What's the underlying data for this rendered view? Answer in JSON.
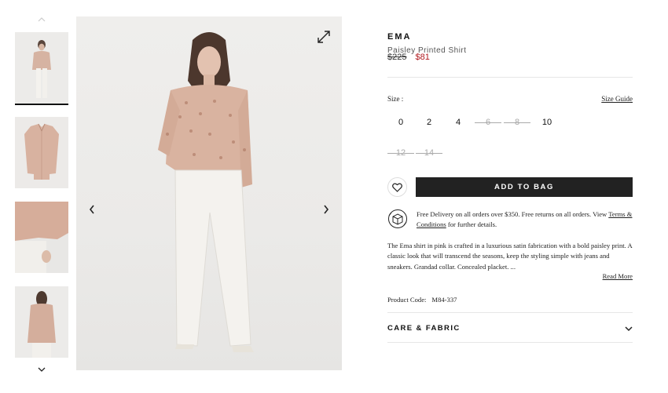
{
  "product": {
    "brand": "EMA",
    "name": "Paisley Printed Shirt",
    "price_original": "$225",
    "price_sale": "$81",
    "product_code_label": "Product Code:",
    "product_code": "M84-337"
  },
  "sizes": {
    "label": "Size :",
    "guide_label": "Size Guide",
    "options": [
      {
        "label": "0",
        "available": true
      },
      {
        "label": "2",
        "available": true
      },
      {
        "label": "4",
        "available": true
      },
      {
        "label": "6",
        "available": false
      },
      {
        "label": "8",
        "available": false
      },
      {
        "label": "10",
        "available": true
      },
      {
        "label": "12",
        "available": false
      },
      {
        "label": "14",
        "available": false
      }
    ]
  },
  "actions": {
    "add_to_bag": "ADD TO BAG"
  },
  "delivery": {
    "text_before": "Free Delivery on all orders over $350. Free returns on all orders. View ",
    "link": "Terms & Conditions",
    "text_after": " for further details."
  },
  "description": {
    "text": "The Ema shirt in pink is crafted in a luxurious satin fabrication with a bold paisley print. A classic look that will transcend the seasons, keep the styling simple with jeans and sneakers. Grandad collar. Concealed placket. ...",
    "read_more": "Read More"
  },
  "accordion": {
    "care_label": "CARE & FABRIC"
  },
  "colors": {
    "sale_red": "#b0191e",
    "button_dark": "#222222"
  }
}
